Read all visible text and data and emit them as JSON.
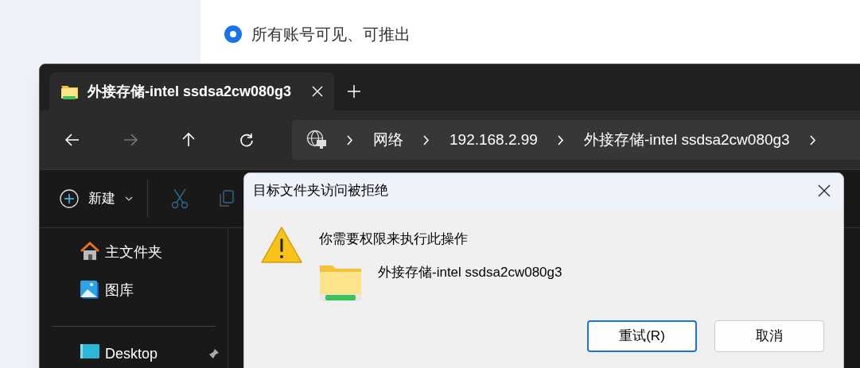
{
  "background_page": {
    "radio_option": {
      "label": "所有账号可见、可推出",
      "selected": true
    }
  },
  "explorer": {
    "tabs": [
      {
        "title": "外接存储-intel ssdsa2cw080g3",
        "selected": true
      }
    ],
    "nav_buttons": [
      {
        "kind": "back",
        "disabled": false
      },
      {
        "kind": "forward",
        "disabled": true
      },
      {
        "kind": "up",
        "disabled": false
      },
      {
        "kind": "refresh",
        "disabled": false
      }
    ],
    "breadcrumb": [
      "网络",
      "192.168.2.99",
      "外接存储-intel ssdsa2cw080g3"
    ],
    "toolbar": {
      "new_button": "新建"
    },
    "sidebar": {
      "groups": [
        [
          {
            "label": "主文件夹",
            "kind": "home"
          },
          {
            "label": "图库",
            "kind": "gallery"
          }
        ],
        [
          {
            "label": "Desktop",
            "kind": "desktop",
            "pinned": true
          }
        ]
      ]
    }
  },
  "dialog": {
    "title": "目标文件夹访问被拒绝",
    "message": "你需要权限来执行此操作",
    "item_name": "外接存储-intel ssdsa2cw080g3",
    "buttons": [
      {
        "label": "重试(R)",
        "default": true
      },
      {
        "label": "取消",
        "default": false
      }
    ]
  }
}
